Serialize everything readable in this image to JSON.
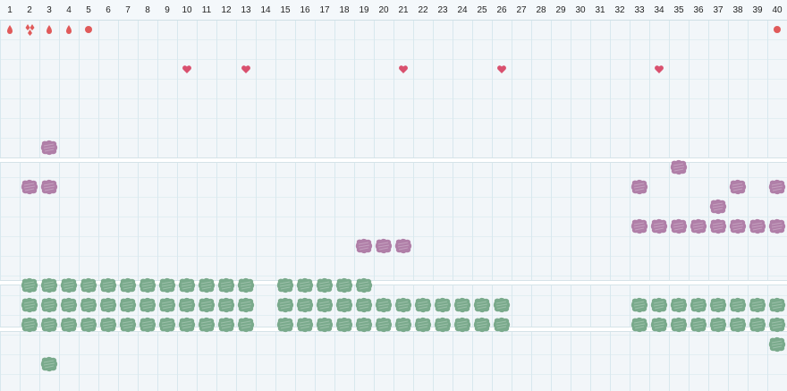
{
  "columns": [
    "1",
    "2",
    "3",
    "4",
    "5",
    "6",
    "7",
    "8",
    "9",
    "10",
    "11",
    "12",
    "13",
    "14",
    "15",
    "16",
    "17",
    "18",
    "19",
    "20",
    "21",
    "22",
    "23",
    "24",
    "25",
    "26",
    "27",
    "28",
    "29",
    "30",
    "31",
    "32",
    "33",
    "34",
    "35",
    "36",
    "37",
    "38",
    "39",
    "40"
  ],
  "colors": {
    "red": "#e05a5a",
    "heart": "#d9506e",
    "purple": "#b07fa8",
    "green": "#7aaa8c",
    "grid": "#d8e8ee",
    "background": "#f2f6f9"
  },
  "marks": [
    {
      "col": 1,
      "row": 2,
      "icon": "drop-icon"
    },
    {
      "col": 2,
      "row": 2,
      "icon": "double-drop-icon"
    },
    {
      "col": 3,
      "row": 2,
      "icon": "drop-icon"
    },
    {
      "col": 4,
      "row": 2,
      "icon": "drop-icon"
    },
    {
      "col": 5,
      "row": 2,
      "icon": "dot-icon"
    },
    {
      "col": 40,
      "row": 2,
      "icon": "dot-icon"
    },
    {
      "col": 10,
      "row": 4,
      "icon": "heart-icon"
    },
    {
      "col": 13,
      "row": 4,
      "icon": "heart-icon"
    },
    {
      "col": 21,
      "row": 4,
      "icon": "heart-icon"
    },
    {
      "col": 26,
      "row": 4,
      "icon": "heart-icon"
    },
    {
      "col": 34,
      "row": 4,
      "icon": "heart-icon"
    }
  ],
  "purple_blobs": [
    {
      "row": 8,
      "cols": [
        3
      ]
    },
    {
      "row": 9,
      "cols": [
        35
      ]
    },
    {
      "row": 10,
      "cols": [
        2,
        3,
        33,
        38,
        40
      ]
    },
    {
      "row": 11,
      "cols": [
        37
      ]
    },
    {
      "row": 12,
      "cols": [
        33,
        34,
        35,
        36,
        37,
        38,
        39,
        40
      ]
    },
    {
      "row": 13,
      "cols": [
        19,
        20,
        21
      ]
    }
  ],
  "green_blobs": [
    {
      "row": 15,
      "cols": [
        2,
        3,
        4,
        5,
        6,
        7,
        8,
        9,
        10,
        11,
        12,
        13,
        15,
        16,
        17,
        18,
        19
      ]
    },
    {
      "row": 16,
      "cols": [
        2,
        3,
        4,
        5,
        6,
        7,
        8,
        9,
        10,
        11,
        12,
        13,
        15,
        16,
        17,
        18,
        19,
        20,
        21,
        22,
        23,
        24,
        25,
        26,
        33,
        34,
        35,
        36,
        37,
        38,
        39,
        40
      ]
    },
    {
      "row": 17,
      "cols": [
        2,
        3,
        4,
        5,
        6,
        7,
        8,
        9,
        10,
        11,
        12,
        13,
        15,
        16,
        17,
        18,
        19,
        20,
        21,
        22,
        23,
        24,
        25,
        26,
        33,
        34,
        35,
        36,
        37,
        38,
        39,
        40
      ]
    },
    {
      "row": 18,
      "cols": [
        40
      ]
    },
    {
      "row": 19,
      "cols": [
        3
      ]
    }
  ]
}
